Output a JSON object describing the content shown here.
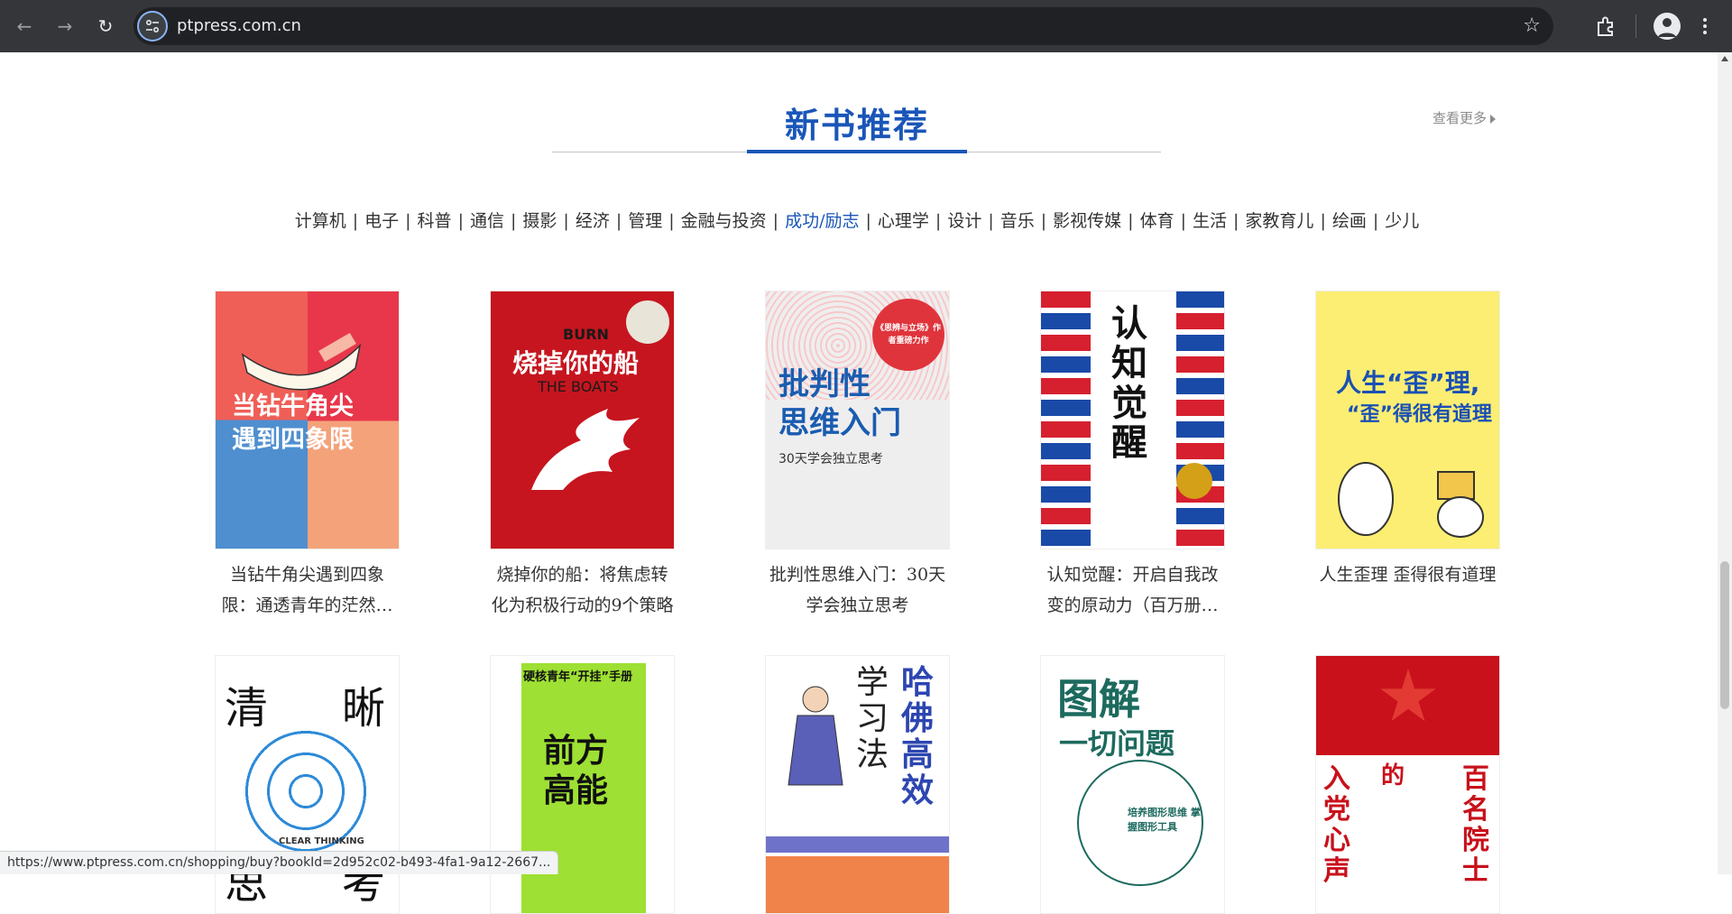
{
  "browser": {
    "url": "ptpress.com.cn",
    "status_url": "https://www.ptpress.com.cn/shopping/buy?bookId=2d952c02-b493-4fa1-9a12-2667..."
  },
  "section": {
    "title": "新书推荐",
    "see_more": "查看更多"
  },
  "categories": [
    {
      "label": "计算机",
      "active": false
    },
    {
      "label": "电子",
      "active": false
    },
    {
      "label": "科普",
      "active": false
    },
    {
      "label": "通信",
      "active": false
    },
    {
      "label": "摄影",
      "active": false
    },
    {
      "label": "经济",
      "active": false
    },
    {
      "label": "管理",
      "active": false
    },
    {
      "label": "金融与投资",
      "active": false
    },
    {
      "label": "成功/励志",
      "active": true
    },
    {
      "label": "心理学",
      "active": false
    },
    {
      "label": "设计",
      "active": false
    },
    {
      "label": "音乐",
      "active": false
    },
    {
      "label": "影视传媒",
      "active": false
    },
    {
      "label": "体育",
      "active": false
    },
    {
      "label": "生活",
      "active": false
    },
    {
      "label": "家教育儿",
      "active": false
    },
    {
      "label": "绘画",
      "active": false
    },
    {
      "label": "少儿",
      "active": false
    }
  ],
  "books": [
    {
      "line1": "当钻牛角尖遇到四象",
      "line2": "限：通透青年的茫然…",
      "cover_title1": "当钻牛角尖",
      "cover_title2": "遇到四象限"
    },
    {
      "line1": "烧掉你的船：将焦虑转",
      "line2": "化为积极行动的9个策略",
      "cover_en1": "BURN",
      "cover_title": "烧掉你的船",
      "cover_en2": "THE BOATS"
    },
    {
      "line1": "批判性思维入门：30天",
      "line2": "学会独立思考",
      "cover_badge": "《思辨与立场》作者重磅力作",
      "cover_title1": "批判性",
      "cover_title2": "思维入门",
      "cover_sub": "30天学会独立思考"
    },
    {
      "line1": "认知觉醒：开启自我改",
      "line2": "变的原动力（百万册…",
      "cover_title": "认知觉醒",
      "cover_sub": "开启自我改变的原动力"
    },
    {
      "line1": "人生歪理 歪得很有道理",
      "line2": "",
      "cover_title1": "人生“歪”理,",
      "cover_title2": "“歪”得很有道理"
    },
    {
      "cover_title1": "清",
      "cover_title2": "晰",
      "cover_title3": "思",
      "cover_title4": "考",
      "cover_en": "CLEAR THINKING"
    },
    {
      "cover_top": "硬核青年“开挂”手册",
      "cover_title1": "前方",
      "cover_title2": "高能"
    },
    {
      "cover_title1": "学习法",
      "cover_title2": "哈佛高效"
    },
    {
      "cover_title1": "图解",
      "cover_title2": "一切问题",
      "cover_sub": "培养图形思维 掌握图形工具"
    },
    {
      "cover_title1": "入党心声",
      "cover_title2": "的",
      "cover_title3": "百名院士"
    }
  ],
  "colors": {
    "accent": "#1a56b8",
    "text": "#333333",
    "muted": "#8a8a8a"
  }
}
